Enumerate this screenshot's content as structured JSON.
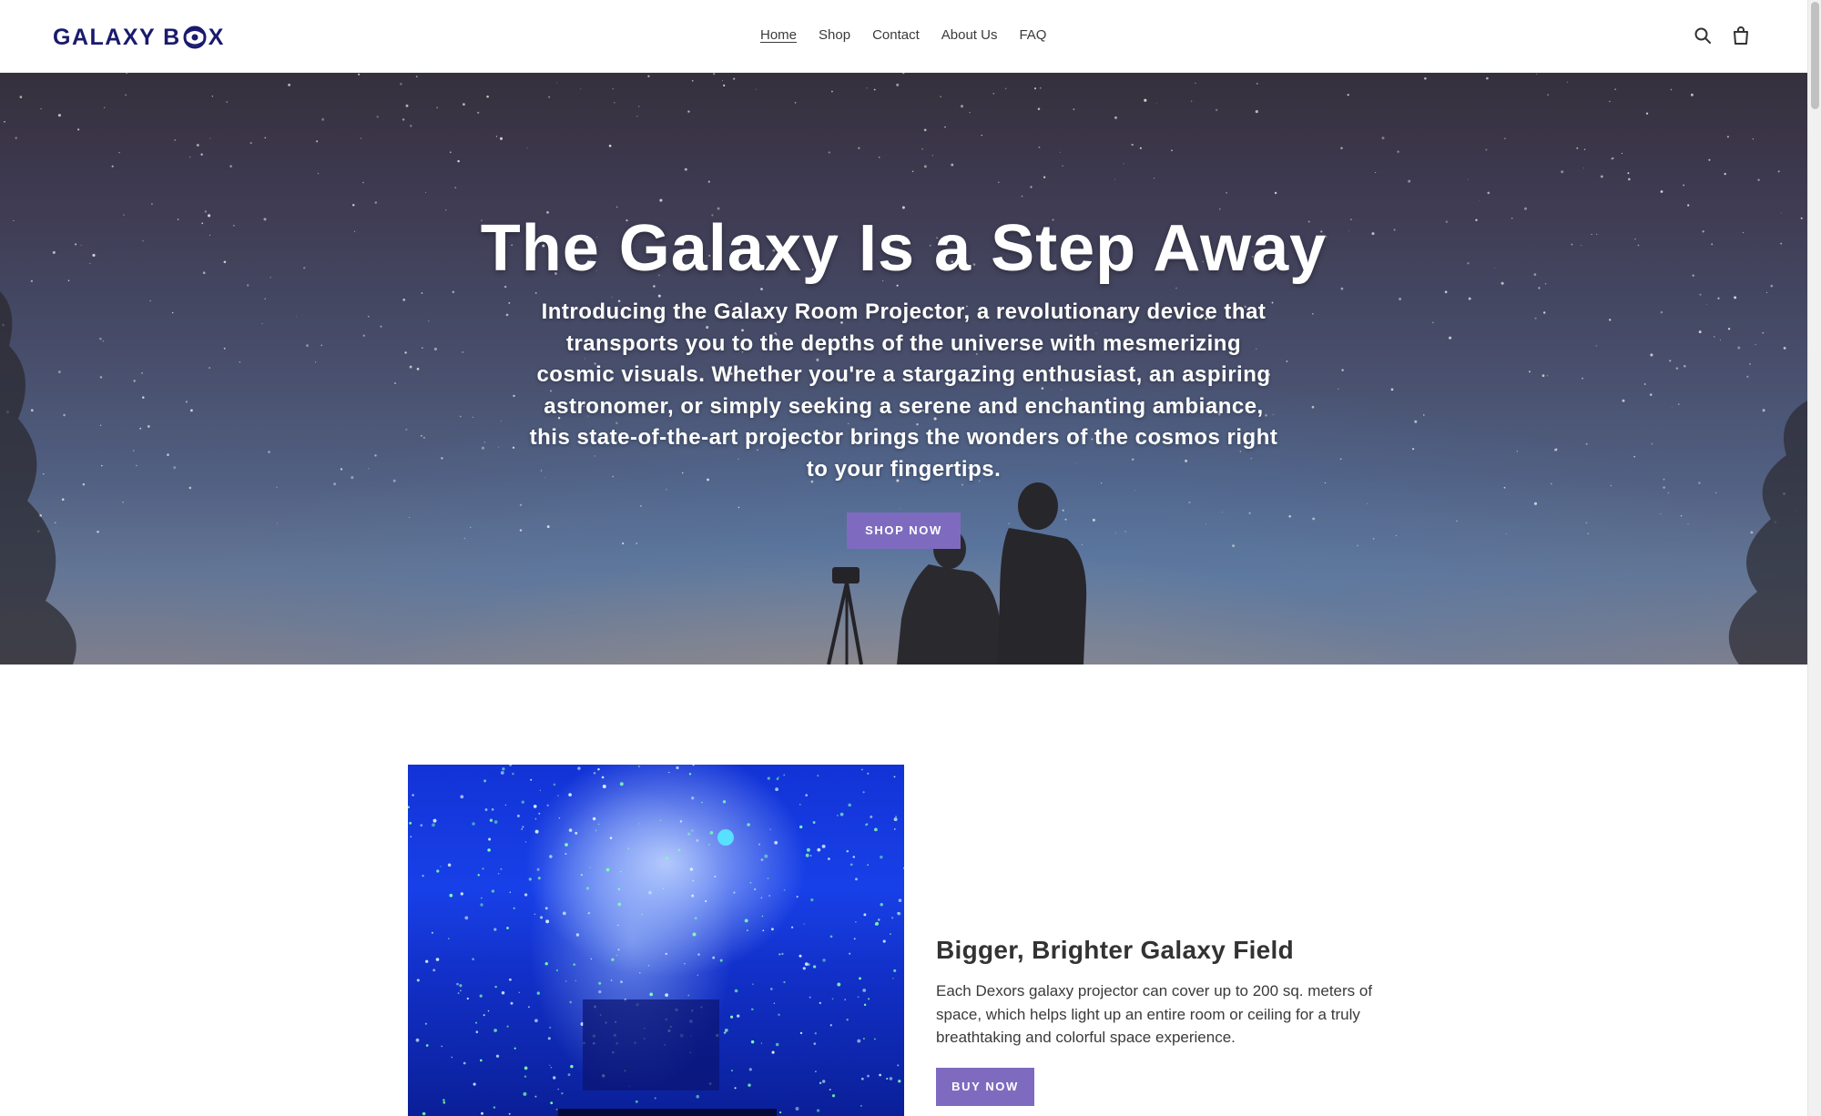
{
  "brand": {
    "logo_text_left": "GALAXY B",
    "logo_text_right": "X",
    "brand_color": "#1a1a6e"
  },
  "nav": {
    "items": [
      {
        "label": "Home",
        "active": true
      },
      {
        "label": "Shop",
        "active": false
      },
      {
        "label": "Contact",
        "active": false
      },
      {
        "label": "About Us",
        "active": false
      },
      {
        "label": "FAQ",
        "active": false
      }
    ]
  },
  "header_icons": {
    "search": "search-icon",
    "cart": "cart-icon"
  },
  "hero": {
    "title": "The Galaxy Is a Step Away",
    "subtitle": "Introducing the Galaxy Room Projector, a revolutionary device that transports you to the depths of the universe with mesmerizing cosmic visuals. Whether you're a stargazing enthusiast, an aspiring astronomer, or simply seeking a serene and enchanting ambiance, this state-of-the-art projector brings the wonders of the cosmos right to your fingertips.",
    "button_label": "SHOP NOW"
  },
  "feature": {
    "title": "Bigger, Brighter Galaxy Field",
    "text": "Each Dexors galaxy projector can cover up to 200 sq. meters of space, which helps light up an entire room or ceiling for a truly breathtaking and colorful space experience.",
    "button_label": "BUY NOW"
  },
  "colors": {
    "accent": "#7e6bbf",
    "text_dark": "#333333"
  }
}
